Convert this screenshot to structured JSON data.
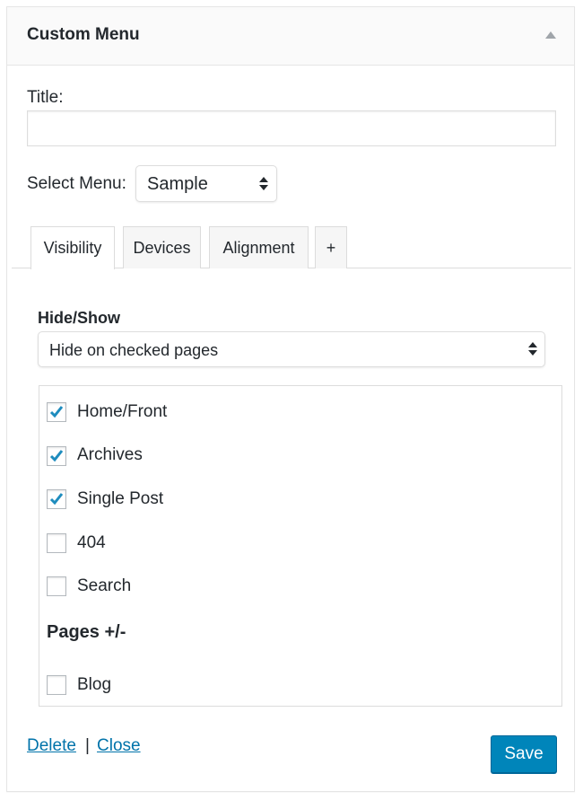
{
  "widget": {
    "title": "Custom Menu",
    "toggle_icon": "triangle-up-icon"
  },
  "form": {
    "title_label": "Title:",
    "title_value": "",
    "title_placeholder": "",
    "select_menu_label": "Select Menu:",
    "select_menu_value": "Sample"
  },
  "tabs": [
    {
      "label": "Visibility",
      "active": true
    },
    {
      "label": "Devices",
      "active": false
    },
    {
      "label": "Alignment",
      "active": false
    },
    {
      "label": "+",
      "active": false
    }
  ],
  "visibility": {
    "heading": "Hide/Show",
    "mode_value": "Hide on checked pages",
    "items": [
      {
        "label": "Home/Front",
        "checked": true
      },
      {
        "label": "Archives",
        "checked": true
      },
      {
        "label": "Single Post",
        "checked": true
      },
      {
        "label": "404",
        "checked": false
      },
      {
        "label": "Search",
        "checked": false
      }
    ],
    "pages_heading": "Pages +/-",
    "pages": [
      {
        "label": "Blog",
        "checked": false
      }
    ]
  },
  "footer": {
    "delete_label": "Delete",
    "separator": "|",
    "close_label": "Close",
    "save_label": "Save"
  },
  "colors": {
    "accent": "#0085ba",
    "link": "#0073aa",
    "check": "#1e8cbe"
  }
}
